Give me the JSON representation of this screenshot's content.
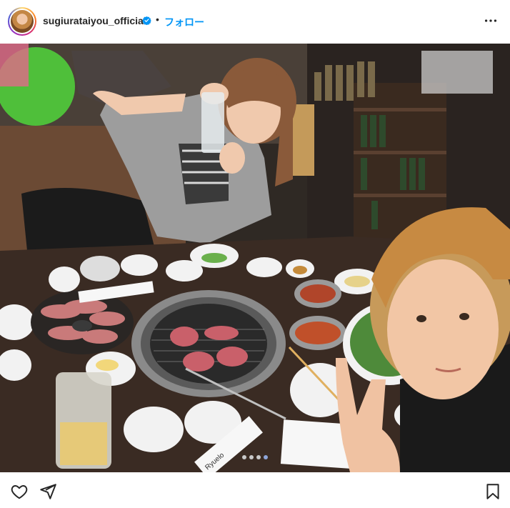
{
  "post": {
    "username": "sugiurataiyou_official",
    "separator": "•",
    "follow_label": "フォロー",
    "verified": true
  },
  "carousel": {
    "total": 4,
    "active_index": 3
  },
  "actions": {
    "like_icon": "heart-icon",
    "share_icon": "send-icon",
    "save_icon": "bookmark-icon"
  },
  "photo": {
    "printed_texts": [
      "Ryuelo"
    ]
  },
  "colors": {
    "follow": "#0095f6",
    "verified": "#0095f6",
    "dot_active": "#8ea6d9",
    "dot_inactive": "#c9c9c9"
  }
}
